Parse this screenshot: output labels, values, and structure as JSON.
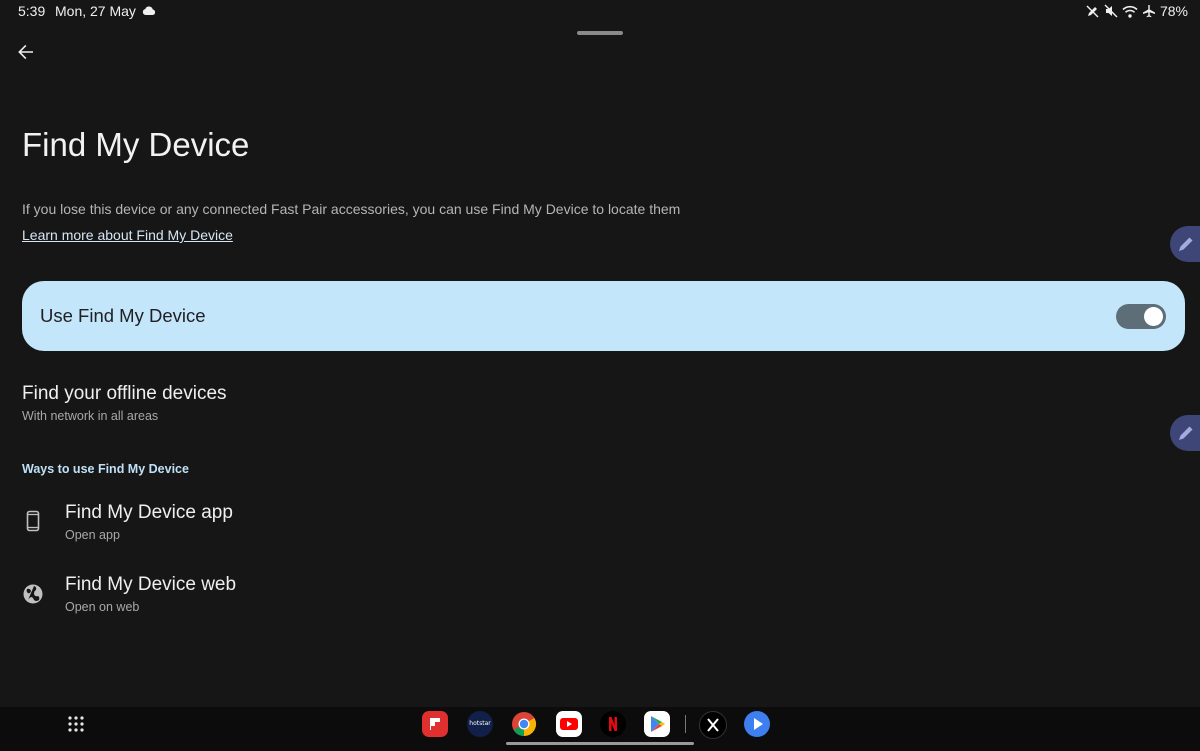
{
  "status_bar": {
    "time": "5:39",
    "date": "Mon, 27 May",
    "battery": "78%",
    "icons": [
      "cloud-icon",
      "pen-off-icon",
      "mute-icon",
      "wifi-icon",
      "airplane-icon"
    ]
  },
  "header": {
    "back_icon": "back-arrow-icon",
    "title": "Find My Device"
  },
  "intro": {
    "description": "If you lose this device or any connected Fast Pair accessories, you can use Find My Device to locate them",
    "learn_more": "Learn more about Find My Device"
  },
  "main_toggle": {
    "label": "Use Find My Device",
    "enabled": true,
    "card_color": "#c4e6fb"
  },
  "offline": {
    "title": "Find your offline devices",
    "subtitle": "With network in all areas"
  },
  "ways_section": {
    "header": "Ways to use Find My Device",
    "items": [
      {
        "title": "Find My Device app",
        "subtitle": "Open app",
        "icon": "phone-icon"
      },
      {
        "title": "Find My Device web",
        "subtitle": "Open on web",
        "icon": "globe-icon"
      }
    ]
  },
  "taskbar": {
    "apps": [
      {
        "name": "flipboard-app",
        "color": "#e02f2f"
      },
      {
        "name": "disney-hotstar-app",
        "color": "#102048"
      },
      {
        "name": "chrome-app",
        "color": "#4285f4"
      },
      {
        "name": "youtube-app",
        "color": "#ff0000"
      },
      {
        "name": "netflix-app",
        "color": "#e50914"
      },
      {
        "name": "play-store-app",
        "color": "#34a853"
      },
      {
        "name": "x-app",
        "color": "#000000"
      },
      {
        "name": "play-video-app",
        "color": "#3d7ff0"
      }
    ],
    "hotstar_text": "hotstar"
  },
  "colors": {
    "background": "#161616",
    "accent": "#bfe0f7",
    "switch_track": "#5e6e78"
  }
}
